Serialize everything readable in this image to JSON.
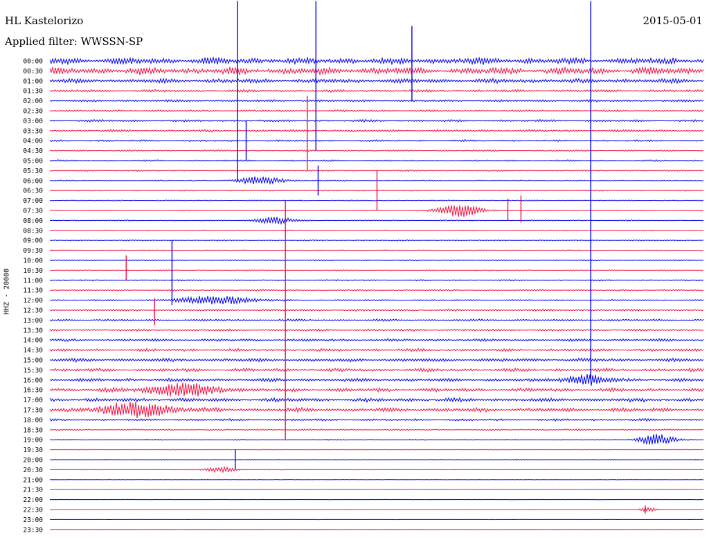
{
  "header": {
    "station": "HL Kastelorizo",
    "filter": "Applied filter: WWSSN-SP",
    "date": "2015-05-01",
    "channel": "HHZ - 20000"
  },
  "colors": {
    "trace_a": "#0000ee",
    "trace_b": "#ee1144"
  },
  "chart_data": {
    "type": "line",
    "title": "HL Kastelorizo",
    "subtitle": "Applied filter: WWSSN-SP",
    "ylabel": "HHZ - 20000",
    "date": "2015-05-01",
    "line_minutes": 30,
    "alternating_colors": [
      "#0000ee",
      "#ee1144"
    ],
    "grid": false,
    "legend": "none",
    "rows": [
      {
        "label": "00:00",
        "noise": 0.9
      },
      {
        "label": "00:30",
        "noise": 0.95
      },
      {
        "label": "01:00",
        "noise": 0.6
      },
      {
        "label": "01:30",
        "noise": 0.35
      },
      {
        "label": "02:00",
        "noise": 0.3
      },
      {
        "label": "02:30",
        "noise": 0.25
      },
      {
        "label": "03:00",
        "noise": 0.3
      },
      {
        "label": "03:30",
        "noise": 0.3
      },
      {
        "label": "04:00",
        "noise": 0.25
      },
      {
        "label": "04:30",
        "noise": 0.2
      },
      {
        "label": "05:00",
        "noise": 0.22
      },
      {
        "label": "05:30",
        "noise": 0.2
      },
      {
        "label": "06:00",
        "noise": 0.15
      },
      {
        "label": "06:30",
        "noise": 0.15
      },
      {
        "label": "07:00",
        "noise": 0.15
      },
      {
        "label": "07:30",
        "noise": 0.15
      },
      {
        "label": "08:00",
        "noise": 0.15
      },
      {
        "label": "08:30",
        "noise": 0.14
      },
      {
        "label": "09:00",
        "noise": 0.14
      },
      {
        "label": "09:30",
        "noise": 0.14
      },
      {
        "label": "10:00",
        "noise": 0.14
      },
      {
        "label": "10:30",
        "noise": 0.15
      },
      {
        "label": "11:00",
        "noise": 0.18
      },
      {
        "label": "11:30",
        "noise": 0.2
      },
      {
        "label": "12:00",
        "noise": 0.2
      },
      {
        "label": "12:30",
        "noise": 0.25
      },
      {
        "label": "13:00",
        "noise": 0.28
      },
      {
        "label": "13:30",
        "noise": 0.3
      },
      {
        "label": "14:00",
        "noise": 0.35
      },
      {
        "label": "14:30",
        "noise": 0.4
      },
      {
        "label": "15:00",
        "noise": 0.45
      },
      {
        "label": "15:30",
        "noise": 0.45
      },
      {
        "label": "16:00",
        "noise": 0.45
      },
      {
        "label": "16:30",
        "noise": 0.5
      },
      {
        "label": "17:00",
        "noise": 0.5
      },
      {
        "label": "17:30",
        "noise": 0.55
      },
      {
        "label": "18:00",
        "noise": 0.3
      },
      {
        "label": "18:30",
        "noise": 0.2
      },
      {
        "label": "19:00",
        "noise": 0.12
      },
      {
        "label": "19:30",
        "noise": 0.1
      },
      {
        "label": "20:00",
        "noise": 0.1
      },
      {
        "label": "20:30",
        "noise": 0.08
      },
      {
        "label": "21:00",
        "noise": 0.06
      },
      {
        "label": "21:30",
        "noise": 0.06
      },
      {
        "label": "22:00",
        "noise": 0.05
      },
      {
        "label": "22:30",
        "noise": 0.05
      },
      {
        "label": "23:00",
        "noise": 0.05
      },
      {
        "label": "23:30",
        "noise": 0.05
      }
    ],
    "events": [
      {
        "row": 0,
        "minute": 8.6,
        "up": 6.0,
        "down": 12.0
      },
      {
        "row": 0,
        "minute": 12.2,
        "up": 6.0,
        "down": 9.0
      },
      {
        "row": 0,
        "minute": 16.6,
        "up": 3.5,
        "down": 4.0
      },
      {
        "row": 0,
        "minute": 24.8,
        "up": 6.0,
        "down": 32.0
      },
      {
        "row": 7,
        "minute": 11.8,
        "up": 3.5,
        "down": 4.0
      },
      {
        "row": 8,
        "minute": 9.0,
        "up": 2.0,
        "down": 2.0
      },
      {
        "row": 12,
        "minute": 12.3,
        "up": 1.5,
        "down": 1.5
      },
      {
        "row": 13,
        "minute": 15.0,
        "up": 2.0,
        "down": 2.0
      },
      {
        "row": 15,
        "minute": 21.0,
        "up": 1.2,
        "down": 1.0
      },
      {
        "row": 15,
        "minute": 21.6,
        "up": 1.5,
        "down": 1.2
      },
      {
        "row": 21,
        "minute": 3.5,
        "up": 1.5,
        "down": 1.0
      },
      {
        "row": 22,
        "minute": 5.6,
        "up": 4.0,
        "down": 2.5
      },
      {
        "row": 25,
        "minute": 4.8,
        "up": 1.2,
        "down": 1.5
      },
      {
        "row": 29,
        "minute": 10.8,
        "up": 15.0,
        "down": 9.0
      },
      {
        "row": 40,
        "minute": 8.5,
        "up": 1.0,
        "down": 1.0
      },
      {
        "row": 45,
        "minute": 27.3,
        "up": 0.4,
        "down": 0.4
      }
    ],
    "bursts": [
      {
        "row": 12,
        "minute": 9.7,
        "width": 1.5,
        "amp": 0.6
      },
      {
        "row": 15,
        "minute": 18.8,
        "width": 1.5,
        "amp": 0.9
      },
      {
        "row": 16,
        "minute": 10.3,
        "width": 1.2,
        "amp": 0.5
      },
      {
        "row": 24,
        "minute": 7.6,
        "width": 2.5,
        "amp": 0.6
      },
      {
        "row": 32,
        "minute": 24.5,
        "width": 1.5,
        "amp": 0.7
      },
      {
        "row": 33,
        "minute": 6.0,
        "width": 2.5,
        "amp": 0.9
      },
      {
        "row": 35,
        "minute": 4.0,
        "width": 2.5,
        "amp": 1.0
      },
      {
        "row": 38,
        "minute": 27.8,
        "width": 1.2,
        "amp": 0.8
      },
      {
        "row": 41,
        "minute": 7.8,
        "width": 1.0,
        "amp": 0.4
      },
      {
        "row": 45,
        "minute": 27.4,
        "width": 0.5,
        "amp": 0.4
      }
    ]
  }
}
